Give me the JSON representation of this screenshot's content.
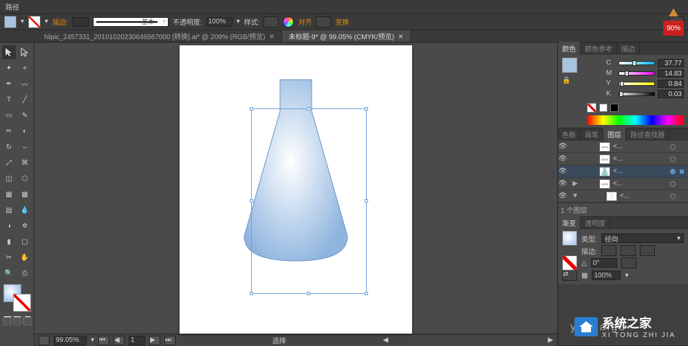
{
  "menubar": {
    "pathLabel": "路径"
  },
  "optbar": {
    "strokeLabel": "描边:",
    "strokeWidth": "",
    "strokeStyleLabel": "基本",
    "opacityLabel": "不透明度:",
    "opacity": "100%",
    "styleLabel": "样式:",
    "alignLabel": "对齐",
    "transformLabel": "变换"
  },
  "tabs": {
    "t0": "Nipic_2457331_20101020230646567000 [转换].ai* @ 209% (RGB/预览)",
    "t1": "未标题-9* @ 99.05% (CMYK/预览)"
  },
  "status": {
    "zoom": "99.05%",
    "artboardNav": "1",
    "tool": "选择"
  },
  "panels": {
    "color": {
      "tabColor": "颜色",
      "tabGuide": "颜色参考",
      "tabStroke": "描边",
      "c": {
        "label": "C",
        "val": "37.77",
        "pct": 38
      },
      "m": {
        "label": "M",
        "val": "14.83",
        "pct": 15
      },
      "y": {
        "label": "Y",
        "val": "0.84",
        "pct": 1
      },
      "k": {
        "label": "K",
        "val": "0.03",
        "pct": 0
      }
    },
    "layers": {
      "tabSwatch": "色板",
      "tabBrush": "画笔",
      "tabLayer": "图层",
      "tabPathfinder": "路径查找器",
      "rows": {
        "r0": "<...",
        "r1": "<...",
        "r2": "<...",
        "r3": "<...",
        "r4": "<..."
      },
      "count": "1 个图层"
    },
    "gradient": {
      "tabGradient": "渐变",
      "tabTransparency": "透明度",
      "typeLabel": "类型:",
      "typeValue": "径向",
      "strokeLabel": "描边:",
      "angleValue": "0°",
      "opacityValue": "100%"
    }
  },
  "badge": {
    "value": "90%"
  },
  "watermark": {
    "big": "系统之家",
    "sub": "XI TONG ZHI JIA",
    "ghost": "yangaigu"
  }
}
